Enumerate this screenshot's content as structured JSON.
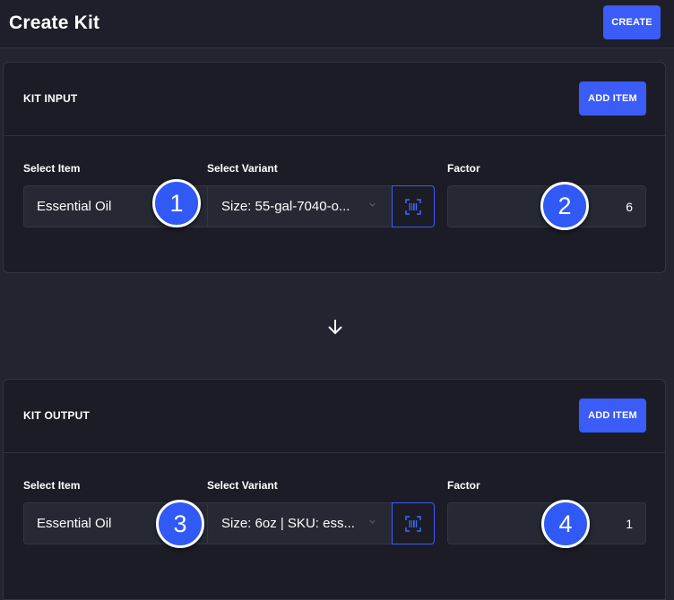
{
  "header": {
    "title": "Create Kit",
    "create_label": "CREATE"
  },
  "kit_input": {
    "title": "KIT INPUT",
    "add_label": "ADD ITEM",
    "item_label": "Select Item",
    "variant_label": "Select Variant",
    "factor_label": "Factor",
    "item_value": "Essential Oil",
    "variant_value": "Size: 55-gal-7040-o...",
    "factor_value": "6"
  },
  "kit_output": {
    "title": "KIT OUTPUT",
    "add_label": "ADD ITEM",
    "item_label": "Select Item",
    "variant_label": "Select Variant",
    "factor_label": "Factor",
    "item_value": "Essential Oil",
    "variant_value": "Size: 6oz | SKU: ess...",
    "factor_value": "1"
  },
  "callouts": [
    "1",
    "2",
    "3",
    "4"
  ],
  "colors": {
    "accent": "#3b5cf6",
    "background": "#23242f",
    "card": "#1b1c26"
  },
  "icons": {
    "scan": "barcode-scan-icon",
    "dropdown": "chevron-down-icon",
    "flow": "arrow-down-icon"
  }
}
